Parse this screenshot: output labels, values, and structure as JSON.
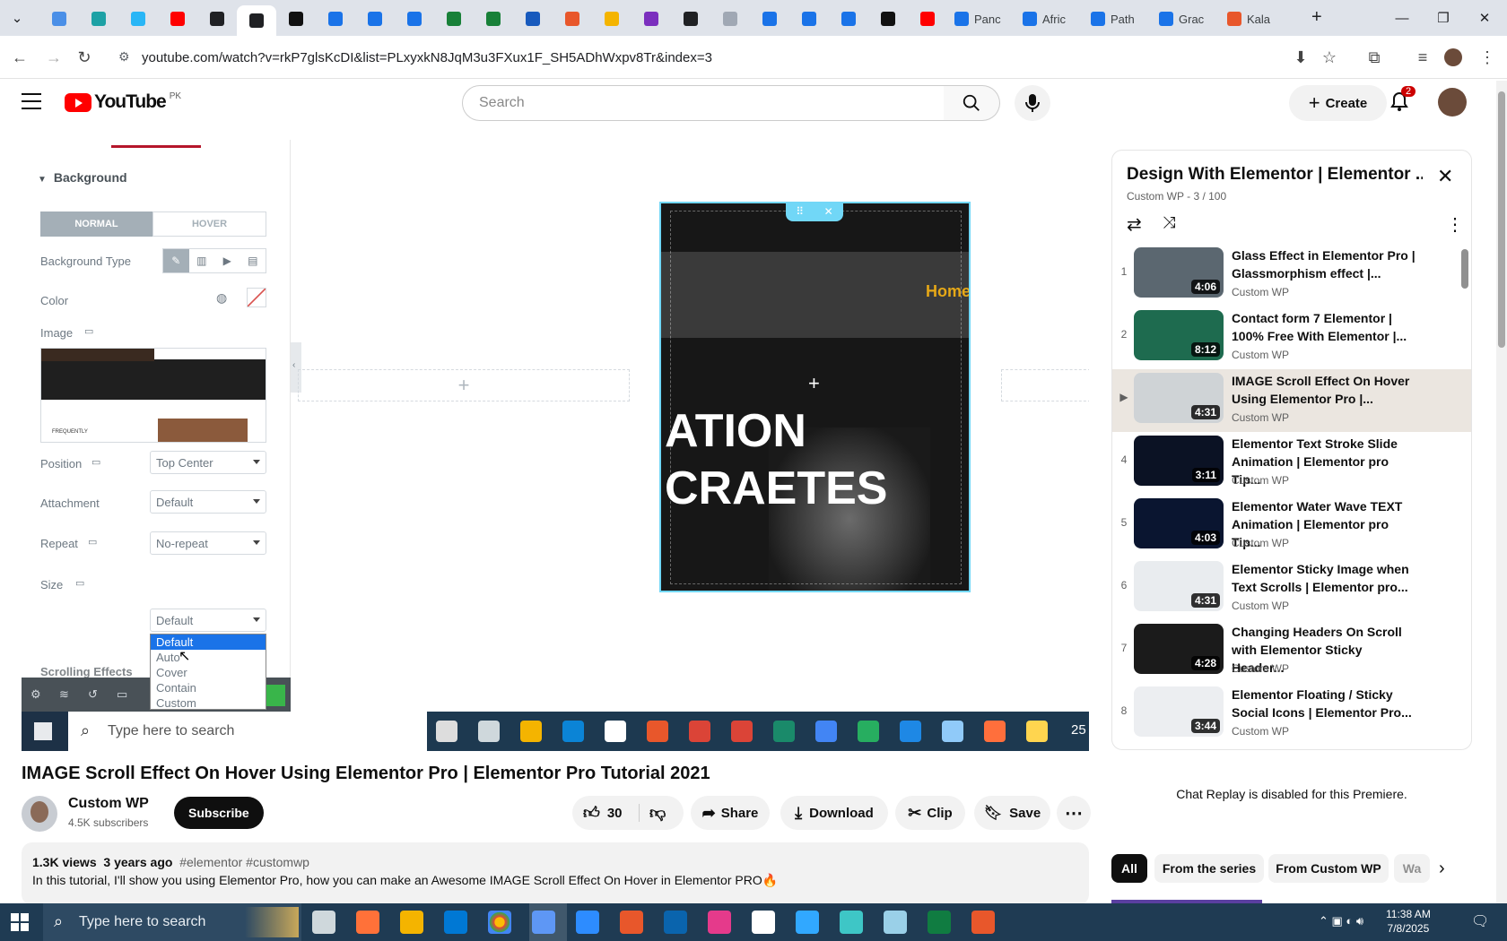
{
  "browser": {
    "tabs": [
      {
        "color": "#4a8fe7"
      },
      {
        "color": "#1da1a5"
      },
      {
        "color": "#29b6f6"
      },
      {
        "color": "#ff0000"
      },
      {
        "color": "#202124"
      },
      {
        "color": "#202124",
        "active": true
      },
      {
        "color": "#111111"
      },
      {
        "color": "#1a73e8"
      },
      {
        "color": "#1a73e8"
      },
      {
        "color": "#1a73e8"
      },
      {
        "color": "#188038"
      },
      {
        "color": "#188038"
      },
      {
        "color": "#185abd"
      },
      {
        "color": "#e8572b"
      },
      {
        "color": "#f4b400"
      },
      {
        "color": "#7b2fbe"
      },
      {
        "color": "#202124"
      },
      {
        "color": "#a0a8b4"
      },
      {
        "color": "#1a73e8"
      },
      {
        "color": "#1a73e8"
      },
      {
        "color": "#1a73e8"
      },
      {
        "color": "#111111"
      },
      {
        "color": "#ff0000"
      },
      {
        "color": "#1a73e8",
        "title": "Panc"
      },
      {
        "color": "#1a73e8",
        "title": "Afric"
      },
      {
        "color": "#1a73e8",
        "title": "Path"
      },
      {
        "color": "#1a73e8",
        "title": "Grac"
      },
      {
        "color": "#e8572b",
        "title": "Kala"
      }
    ],
    "url": "youtube.com/watch?v=rkP7glsKcDI&list=PLxyxkN8JqM3u3FXux1F_SH5ADhWxpv8Tr&index=3"
  },
  "yt": {
    "logo": "YouTube",
    "region": "PK",
    "search_placeholder": "Search",
    "create_label": "Create",
    "notif_count": "2"
  },
  "editor": {
    "section": "Background",
    "tab_normal": "NORMAL",
    "tab_hover": "HOVER",
    "bg_type_label": "Background Type",
    "color_label": "Color",
    "image_label": "Image",
    "thumb_caption": "FREQUENTLY",
    "position_label": "Position",
    "position_value": "Top Center",
    "attachment_label": "Attachment",
    "attachment_value": "Default",
    "repeat_label": "Repeat",
    "repeat_value": "No-repeat",
    "size_label": "Size",
    "size_value": "Default",
    "scrolling_label": "Scrolling Effects",
    "size_options": [
      "Default",
      "Auto",
      "Cover",
      "Contain",
      "Custom"
    ],
    "canvas_text1": "ATION",
    "canvas_text2": "CRAETES",
    "canvas_menu": "Home",
    "inner_taskbar_search": "Type here to search",
    "inner_taskbar_num": "25"
  },
  "video": {
    "title": "IMAGE Scroll Effect On Hover Using Elementor Pro | Elementor Pro Tutorial 2021",
    "channel": "Custom WP",
    "subscribers": "4.5K subscribers",
    "subscribe_label": "Subscribe",
    "likes": "30",
    "share_label": "Share",
    "download_label": "Download",
    "clip_label": "Clip",
    "save_label": "Save",
    "views": "1.3K views",
    "age": "3 years ago",
    "tags": "#elementor #customwp",
    "description": "In this tutorial, I'll show you using Elementor Pro, how you can make an Awesome IMAGE Scroll Effect On Hover in Elementor PRO🔥"
  },
  "playlist": {
    "title": "Design With Elementor | Elementor ...",
    "meta": "Custom WP - 3 / 100",
    "items": [
      {
        "index": "1",
        "title": "Glass Effect in Elementor Pro | Glassmorphism effect |...",
        "channel": "Custom WP",
        "duration": "4:06",
        "bg": "#5b6770"
      },
      {
        "index": "2",
        "title": "Contact form 7 Elementor | 100% Free With Elementor |...",
        "channel": "Custom WP",
        "duration": "8:12",
        "bg": "#1e6b4f"
      },
      {
        "index": "▶",
        "title": "IMAGE Scroll Effect On Hover Using Elementor Pro |...",
        "channel": "Custom WP",
        "duration": "4:31",
        "bg": "#cfd3d6",
        "current": true
      },
      {
        "index": "4",
        "title": "Elementor Text Stroke Slide Animation | Elementor pro Tip...",
        "channel": "Custom WP",
        "duration": "3:11",
        "bg": "#0b1224"
      },
      {
        "index": "5",
        "title": "Elementor Water Wave TEXT Animation | Elementor pro Tip...",
        "channel": "Custom WP",
        "duration": "4:03",
        "bg": "#0a1530"
      },
      {
        "index": "6",
        "title": "Elementor Sticky Image when Text Scrolls | Elementor pro...",
        "channel": "Custom WP",
        "duration": "4:31",
        "bg": "#e9ecef"
      },
      {
        "index": "7",
        "title": "Changing Headers On Scroll with Elementor Sticky Header...",
        "channel": "Custom WP",
        "duration": "4:28",
        "bg": "#1b1b1b"
      },
      {
        "index": "8",
        "title": "Elementor Floating / Sticky Social Icons | Elementor Pro...",
        "channel": "Custom WP",
        "duration": "3:44",
        "bg": "#eceef1"
      }
    ]
  },
  "chat": {
    "message": "Chat Replay is disabled for this Premiere."
  },
  "chips": [
    "All",
    "From the series",
    "From Custom WP",
    "Wa"
  ],
  "taskbar": {
    "search": "Type here to search",
    "time": "11:38 AM",
    "date": "7/8/2025"
  }
}
